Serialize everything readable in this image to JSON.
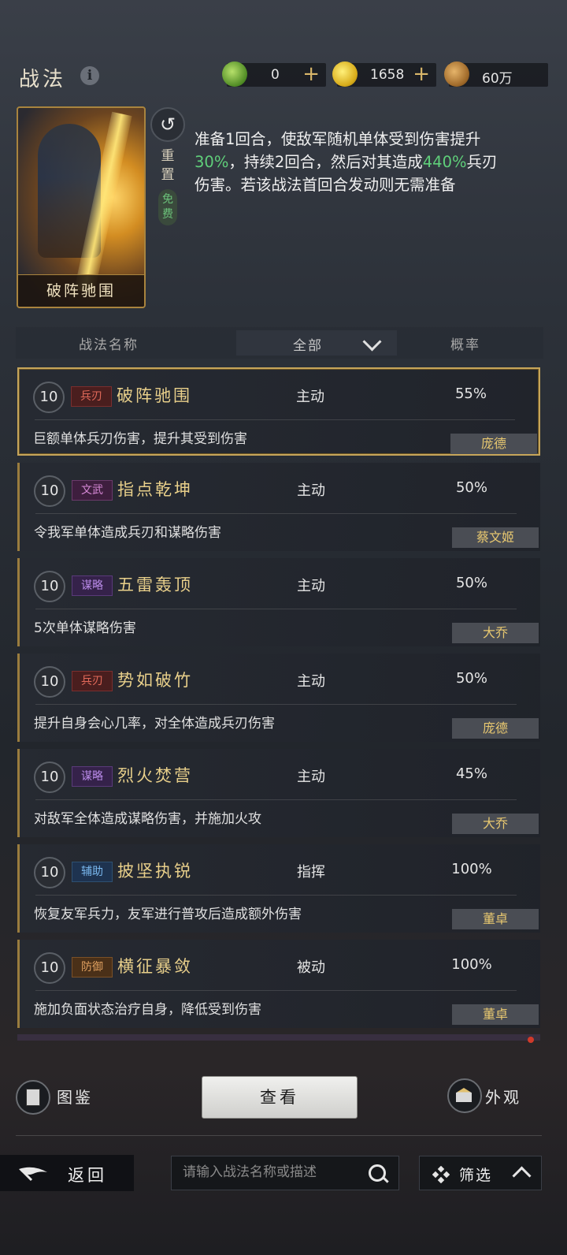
{
  "header": {
    "title": "战法",
    "resources": [
      {
        "icon": "jade-coin-icon",
        "value": "0",
        "color": "#6aa83a"
      },
      {
        "icon": "gold-coin-icon",
        "value": "1658",
        "color": "#e2b825"
      },
      {
        "icon": "copper-coin-icon",
        "value": "60万",
        "color": "#b07a3a"
      }
    ]
  },
  "selected": {
    "card_name": "破阵驰围",
    "reset_label": "重置",
    "free_label": "免费",
    "desc_1": "准备1回合，使敌军随机单体受到伤害提升",
    "desc_hl_1": "30%",
    "desc_2": "，持续2回合，然后对其造成",
    "desc_hl_2": "440%",
    "desc_3": "兵刃伤害。若该战法首回合发动则无需准备"
  },
  "table_header": {
    "name_col": "战法名称",
    "filter_value": "全部",
    "prob_col": "概率"
  },
  "skills": [
    {
      "level": "10",
      "tag": "兵刃",
      "tag_kind": "blade",
      "name": "破阵驰围",
      "type": "主动",
      "prob": "55%",
      "desc": "巨额单体兵刃伤害，提升其受到伤害",
      "hero": "庞德"
    },
    {
      "level": "10",
      "tag": "文武",
      "tag_kind": "wenwu",
      "name": "指点乾坤",
      "type": "主动",
      "prob": "50%",
      "desc": "令我军单体造成兵刃和谋略伤害",
      "hero": "蔡文姬"
    },
    {
      "level": "10",
      "tag": "谋略",
      "tag_kind": "mou",
      "name": "五雷轰顶",
      "type": "主动",
      "prob": "50%",
      "desc": "5次单体谋略伤害",
      "hero": "大乔"
    },
    {
      "level": "10",
      "tag": "兵刃",
      "tag_kind": "blade",
      "name": "势如破竹",
      "type": "主动",
      "prob": "50%",
      "desc": "提升自身会心几率，对全体造成兵刃伤害",
      "hero": "庞德"
    },
    {
      "level": "10",
      "tag": "谋略",
      "tag_kind": "mou",
      "name": "烈火焚营",
      "type": "主动",
      "prob": "45%",
      "desc": "对敌军全体造成谋略伤害，并施加火攻",
      "hero": "大乔"
    },
    {
      "level": "10",
      "tag": "辅助",
      "tag_kind": "fuzhu",
      "name": "披坚执锐",
      "type": "指挥",
      "prob": "100%",
      "desc": "恢复友军兵力，友军进行普攻后造成额外伤害",
      "hero": "董卓"
    },
    {
      "level": "10",
      "tag": "防御",
      "tag_kind": "fangyu",
      "name": "横征暴敛",
      "type": "被动",
      "prob": "100%",
      "desc": "施加负面状态治疗自身，降低受到伤害",
      "hero": "董卓"
    }
  ],
  "bottom": {
    "codex_label": "图鉴",
    "view_label": "查看",
    "skin_label": "外观",
    "back_label": "返回",
    "search_placeholder": "请输入战法名称或描述",
    "filter_label": "筛选"
  }
}
